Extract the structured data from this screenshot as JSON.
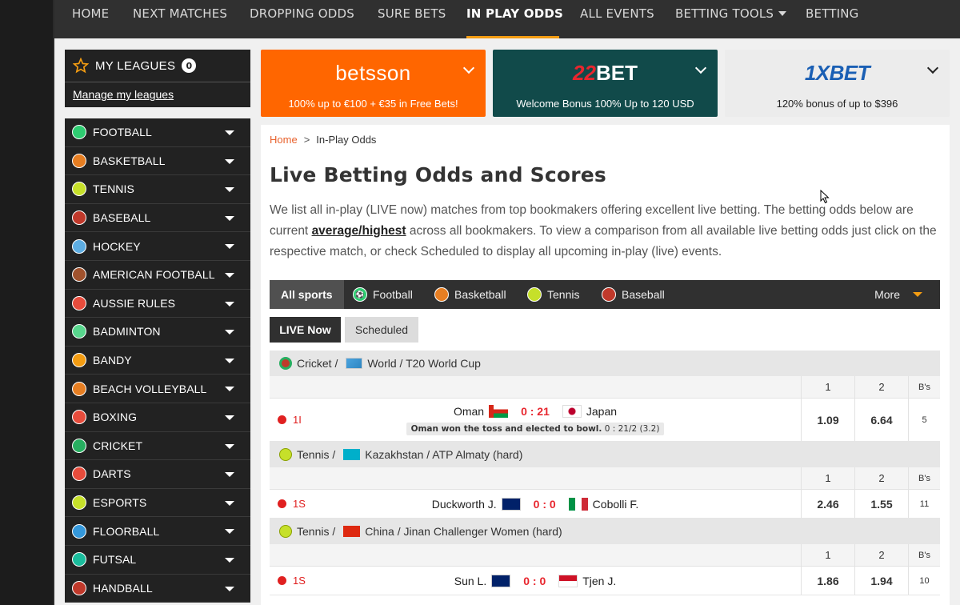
{
  "nav": {
    "items": [
      "HOME",
      "NEXT MATCHES",
      "DROPPING ODDS",
      "SURE BETS",
      "IN PLAY ODDS",
      "ALL EVENTS",
      "BETTING TOOLS",
      "BETTING"
    ],
    "active": "IN PLAY ODDS"
  },
  "my_leagues": {
    "title": "MY LEAGUES",
    "count": "0",
    "manage_link": "Manage my leagues"
  },
  "sports": [
    {
      "label": "FOOTBALL",
      "icon": "football-icon",
      "color": "#2ecc71"
    },
    {
      "label": "BASKETBALL",
      "icon": "basketball-icon",
      "color": "#e67e22"
    },
    {
      "label": "TENNIS",
      "icon": "tennis-icon",
      "color": "#c6e02a"
    },
    {
      "label": "BASEBALL",
      "icon": "baseball-icon",
      "color": "#c0392b"
    },
    {
      "label": "HOCKEY",
      "icon": "hockey-icon",
      "color": "#5dade2"
    },
    {
      "label": "AMERICAN FOOTBALL",
      "icon": "american-football-icon",
      "color": "#a0522d"
    },
    {
      "label": "AUSSIE RULES",
      "icon": "aussie-rules-icon",
      "color": "#e74c3c"
    },
    {
      "label": "BADMINTON",
      "icon": "badminton-icon",
      "color": "#58d68d"
    },
    {
      "label": "BANDY",
      "icon": "bandy-icon",
      "color": "#f39c12"
    },
    {
      "label": "BEACH VOLLEYBALL",
      "icon": "beach-volleyball-icon",
      "color": "#e67e22"
    },
    {
      "label": "BOXING",
      "icon": "boxing-icon",
      "color": "#e74c3c"
    },
    {
      "label": "CRICKET",
      "icon": "cricket-icon",
      "color": "#27ae60"
    },
    {
      "label": "DARTS",
      "icon": "darts-icon",
      "color": "#e74c3c"
    },
    {
      "label": "ESPORTS",
      "icon": "esports-icon",
      "color": "#c6e02a"
    },
    {
      "label": "FLOORBALL",
      "icon": "floorball-icon",
      "color": "#3498db"
    },
    {
      "label": "FUTSAL",
      "icon": "futsal-icon",
      "color": "#1abc9c"
    },
    {
      "label": "HANDBALL",
      "icon": "handball-icon",
      "color": "#c0392b"
    }
  ],
  "banners": [
    {
      "logo": "betsson",
      "text": "100% up to €100 + €35 in Free Bets!"
    },
    {
      "logo": "22BET",
      "text": "Welcome Bonus 100% Up to 120 USD"
    },
    {
      "logo": "1XBET",
      "text": "120% bonus of up to $396"
    }
  ],
  "breadcrumb": {
    "home": "Home",
    "sep": ">",
    "current": "In-Play Odds"
  },
  "title": "Live Betting Odds and Scores",
  "intro": {
    "part1": "We list all in-play (LIVE now) matches from top bookmakers offering excellent live betting. The betting odds below are current ",
    "link": "average/highest",
    "part2": " across all bookmakers. To view  a comparison from all available live betting odds just click on the respective match, or check Scheduled to display all upcoming in-play (live) events."
  },
  "sport_tabs": {
    "all": "All sports",
    "tabs": [
      {
        "label": "Football",
        "icon": "football-icon",
        "color": "#2ecc71"
      },
      {
        "label": "Basketball",
        "icon": "basketball-icon",
        "color": "#e67e22"
      },
      {
        "label": "Tennis",
        "icon": "tennis-icon",
        "color": "#c6e02a"
      },
      {
        "label": "Baseball",
        "icon": "baseball-icon",
        "color": "#c0392b"
      }
    ],
    "more": "More"
  },
  "live_toggle": {
    "live": "LIVE Now",
    "scheduled": "Scheduled"
  },
  "table_headers": {
    "col1": "1",
    "col2": "2",
    "col3": "B's"
  },
  "events": [
    {
      "sport": "Cricket /",
      "league": "World / T20 World Cup",
      "status": "1I",
      "home": "Oman",
      "score": "0 : 21",
      "away": "Japan",
      "note_bold": "Oman won the toss and elected to bowl.",
      "note_rest": " 0 : 21/2 (3.2)",
      "odd1": "1.09",
      "odd2": "6.64",
      "bookmakers": "5"
    },
    {
      "sport": "Tennis /",
      "league": "Kazakhstan / ATP Almaty (hard)",
      "status": "1S",
      "home": "Duckworth J.",
      "score": "0 : 0",
      "away": "Cobolli F.",
      "odd1": "2.46",
      "odd2": "1.55",
      "bookmakers": "11"
    },
    {
      "sport": "Tennis /",
      "league": "China / Jinan Challenger Women (hard)",
      "status": "1S",
      "home": "Sun L.",
      "score": "0 : 0",
      "away": "Tjen J.",
      "odd1": "1.86",
      "odd2": "1.94",
      "bookmakers": "10"
    }
  ]
}
